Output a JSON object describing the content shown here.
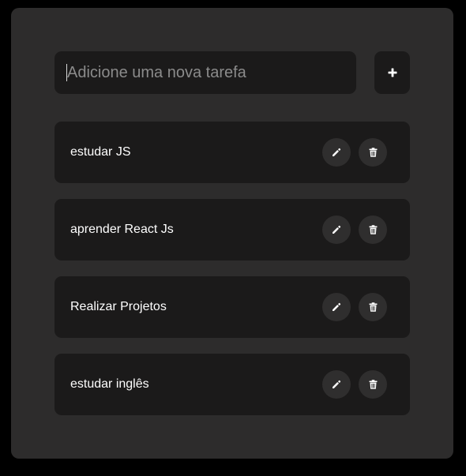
{
  "form": {
    "input_placeholder": "Adicione uma nova tarefa",
    "input_value": "",
    "add_button_icon": "plus-icon"
  },
  "tasks": [
    {
      "label": "estudar JS",
      "edit_icon": "pencil-icon",
      "delete_icon": "trash-icon"
    },
    {
      "label": "aprender React Js",
      "edit_icon": "pencil-icon",
      "delete_icon": "trash-icon"
    },
    {
      "label": "Realizar Projetos",
      "edit_icon": "pencil-icon",
      "delete_icon": "trash-icon"
    },
    {
      "label": "estudar inglês",
      "edit_icon": "pencil-icon",
      "delete_icon": "trash-icon"
    }
  ],
  "colors": {
    "page_background": "#000000",
    "panel_background": "#2d2c2c",
    "card_background": "#1b1a1a",
    "icon_button_background": "#2f2e2e",
    "text": "#ffffff",
    "placeholder": "#8b8b8b"
  }
}
